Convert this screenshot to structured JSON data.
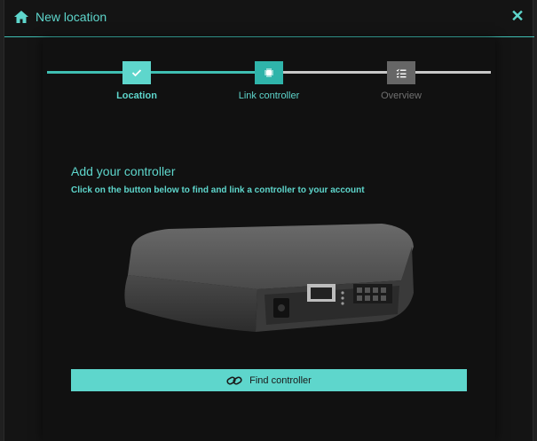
{
  "header": {
    "title": "New location",
    "home_icon": "home-icon",
    "close_symbol": "✕"
  },
  "stepper": {
    "steps": [
      {
        "label": "Location",
        "icon": "check-icon",
        "state": "done"
      },
      {
        "label": "Link controller",
        "icon": "chip-icon",
        "state": "active"
      },
      {
        "label": "Overview",
        "icon": "list-icon",
        "state": "pending"
      }
    ]
  },
  "content": {
    "heading": "Add your controller",
    "subheading": "Click on the button below to find and link a controller to your account",
    "find_button_label": "Find controller"
  },
  "colors": {
    "accent": "#5ed6cc",
    "accent_dark": "#2fb4aa",
    "pending": "#666666",
    "background": "#141414"
  }
}
